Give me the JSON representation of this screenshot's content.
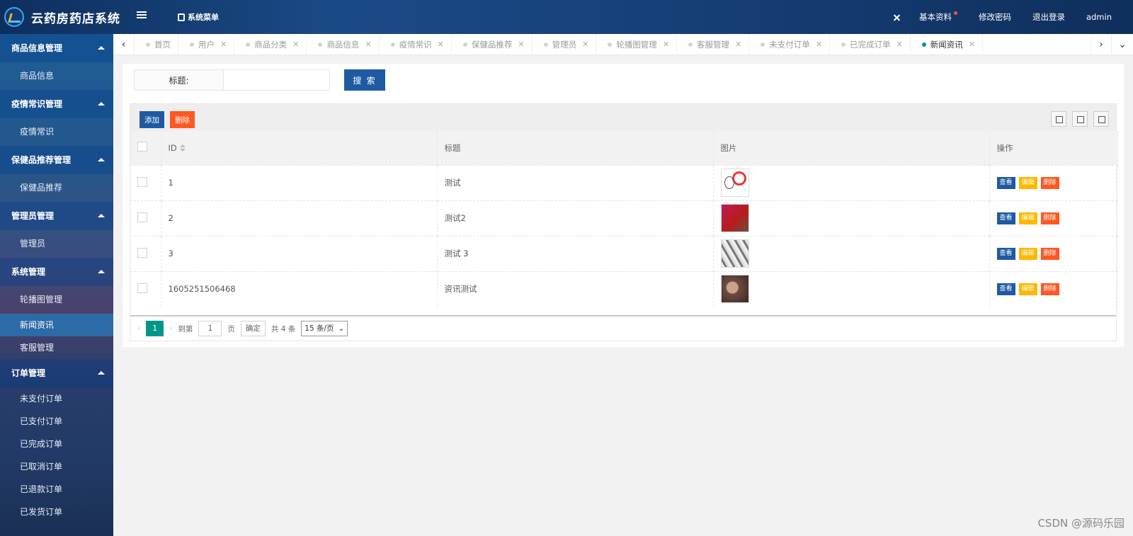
{
  "header": {
    "title": "云药房药店系统",
    "menu_label": "系统菜单",
    "profile": "基本资料",
    "change_password": "修改密码",
    "logout": "退出登录",
    "user": "admin"
  },
  "sidebar": {
    "groups": [
      {
        "label": "商品信息管理",
        "items": [
          "商品信息"
        ]
      },
      {
        "label": "疫情常识管理",
        "items": [
          "疫情常识"
        ]
      },
      {
        "label": "保健品推荐管理",
        "items": [
          "保健品推荐"
        ]
      },
      {
        "label": "管理员管理",
        "items": [
          "管理员"
        ]
      },
      {
        "label": "系统管理",
        "items": [
          "轮播图管理",
          "新闻资讯",
          "客服管理"
        ]
      },
      {
        "label": "订单管理",
        "items": [
          "未支付订单",
          "已支付订单",
          "已完成订单",
          "已取消订单",
          "已退款订单",
          "已发货订单"
        ]
      }
    ],
    "active": "新闻资讯"
  },
  "tabs": [
    "首页",
    "用户",
    "商品分类",
    "商品信息",
    "疫情常识",
    "保健品推荐",
    "管理员",
    "轮播图管理",
    "客服管理",
    "未支付订单",
    "已完成订单",
    "新闻资讯"
  ],
  "active_tab": "新闻资讯",
  "search": {
    "label": "标题:",
    "value": "",
    "button": "搜 索"
  },
  "toolbar": {
    "add": "添加",
    "delete": "删除"
  },
  "table": {
    "columns": [
      "ID",
      "标题",
      "图片",
      "操作"
    ],
    "rows": [
      {
        "id": "1",
        "title": "测试"
      },
      {
        "id": "2",
        "title": "测试2"
      },
      {
        "id": "3",
        "title": "测试 3"
      },
      {
        "id": "1605251506468",
        "title": "资讯测试"
      }
    ],
    "actions": {
      "view": "查看",
      "edit": "编辑",
      "delete": "删除"
    }
  },
  "pager": {
    "current": "1",
    "goto_label": "到第",
    "page_input": "1",
    "page_unit": "页",
    "confirm": "确定",
    "total": "共 4 条",
    "per_page": "15 条/页"
  },
  "watermark": "CSDN @源码乐园"
}
